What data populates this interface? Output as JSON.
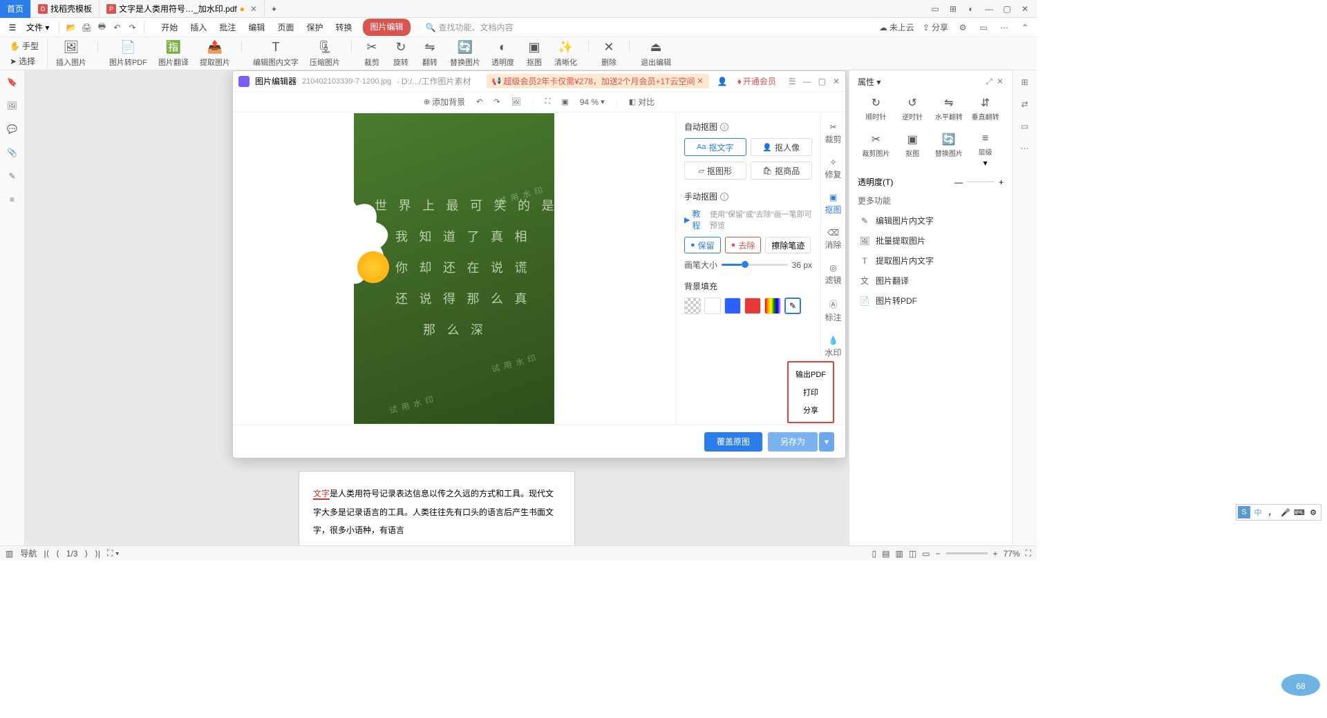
{
  "titlebar": {
    "tabs": [
      {
        "label": "首页",
        "active": true
      },
      {
        "label": "找稻壳模板",
        "icon": "D",
        "iconColor": "#d9534f"
      },
      {
        "label": "文字是人类用符号…_加水印.pdf",
        "icon": "P",
        "iconColor": "#d9534f",
        "dirty": true
      }
    ],
    "add_tab": "+"
  },
  "menubar": {
    "file": "文件",
    "ribbon": [
      "开始",
      "插入",
      "批注",
      "编辑",
      "页面",
      "保护",
      "转换",
      "图片编辑"
    ],
    "search_placeholder": "查找功能、文档内容",
    "cloud": "未上云",
    "share": "分享"
  },
  "left_tools": {
    "hand": "手型",
    "select": "选择"
  },
  "ribbon_tools": [
    {
      "l": "插入图片"
    },
    {
      "l": "图片转PDF"
    },
    {
      "l": "图片翻译"
    },
    {
      "l": "提取图片"
    },
    {
      "l": "编辑图内文字"
    },
    {
      "l": "压缩图片"
    },
    {
      "l": "裁剪"
    },
    {
      "l": "旋转"
    },
    {
      "l": "翻转"
    },
    {
      "l": "替换图片"
    },
    {
      "l": "透明度"
    },
    {
      "l": "抠图"
    },
    {
      "l": "清晰化"
    },
    {
      "l": "删除"
    },
    {
      "l": "退出编辑"
    }
  ],
  "editor": {
    "title": "图片编辑器",
    "filename": "210402103339-7-1200.jpg",
    "path": "D:/.../工作图片素材",
    "promo": "超级会员2年卡仅需¥278，加送2个月会员+1T云空间",
    "vip": "开通会员",
    "toolbar": {
      "add_bg": "添加背景",
      "zoom": "94 %",
      "compare": "对比"
    },
    "image_text": [
      "世 界 上 最 可 笑 的 是",
      "我 知 道 了 真 相",
      "你 却 还 在 说 谎",
      "还 说 得 那 么 真",
      "那 么 深"
    ],
    "wm": "试用水印",
    "auto": {
      "title": "自动抠图",
      "text": "抠文字",
      "portrait": "抠人像",
      "shape": "抠图形",
      "product": "抠商品"
    },
    "manual": {
      "title": "手动抠图",
      "tutorial": "教程",
      "hint": "使用\"保留\"或\"去除\"画一笔即可预览",
      "keep": "保留",
      "remove": "去除",
      "erase": "擦除笔迹",
      "brush": "画笔大小",
      "brush_val": "36 px",
      "bgfill": "背景填充"
    },
    "tabs": [
      "裁剪",
      "修复",
      "抠图",
      "消除",
      "滤镜",
      "标注",
      "水印"
    ],
    "footer": {
      "overwrite": "覆盖原图",
      "saveas": "另存为"
    },
    "dropdown": [
      "输出PDF",
      "打印",
      "分享"
    ]
  },
  "right_panel": {
    "title": "属性",
    "rotate": [
      "顺时针",
      "逆时针",
      "水平翻转",
      "垂直翻转"
    ],
    "crop": [
      "裁剪图片",
      "抠图",
      "替换图片",
      "层级"
    ],
    "opacity": "透明度(T)",
    "more_title": "更多功能",
    "more": [
      "编辑图片内文字",
      "批量提取图片",
      "提取图片内文字",
      "图片翻译",
      "图片转PDF"
    ]
  },
  "statusbar": {
    "nav": "导航",
    "page": "1/3",
    "zoom": "77%"
  },
  "document": {
    "highlight": "文字",
    "body": "是人类用符号记录表达信息以传之久远的方式和工具。现代文字大多是记录语言的工具。人类往往先有口头的语言后产生书面文字，很多小语种，有语言"
  },
  "ime": [
    "中",
    "，"
  ]
}
